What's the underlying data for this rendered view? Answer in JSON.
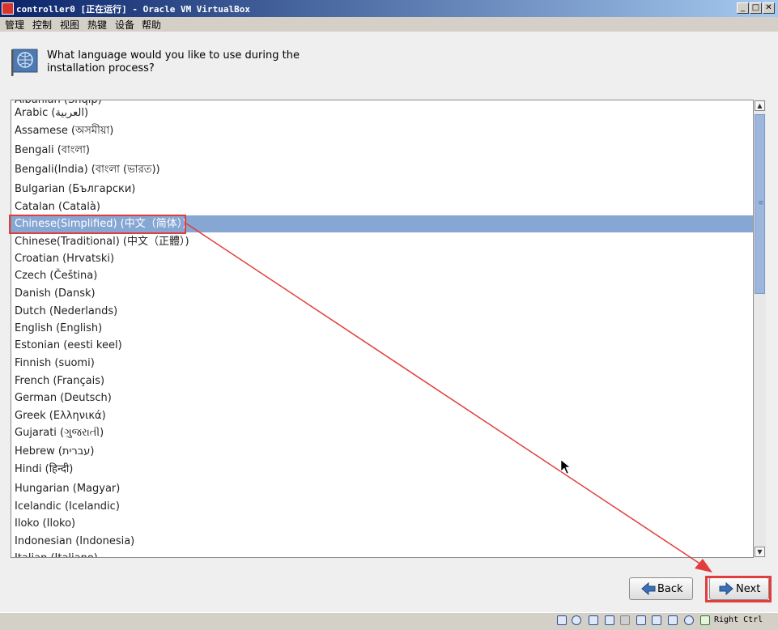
{
  "window": {
    "title": "controller0 [正在运行] - Oracle VM VirtualBox",
    "minimize_glyph": "_",
    "maximize_glyph": "□",
    "close_glyph": "✕"
  },
  "menu": [
    "管理",
    "控制",
    "视图",
    "热键",
    "设备",
    "帮助"
  ],
  "installer": {
    "question": "What language would you like to use during the installation process?",
    "languages": [
      "Albanian (Shqip)",
      "Arabic (العربية)",
      "Assamese (অসমীয়া)",
      "Bengali (বাংলা)",
      "Bengali(India) (বাংলা (ভারত))",
      "Bulgarian (Български)",
      "Catalan (Català)",
      "Chinese(Simplified) (中文（简体）)",
      "Chinese(Traditional) (中文（正體）)",
      "Croatian (Hrvatski)",
      "Czech (Čeština)",
      "Danish (Dansk)",
      "Dutch (Nederlands)",
      "English (English)",
      "Estonian (eesti keel)",
      "Finnish (suomi)",
      "French (Français)",
      "German (Deutsch)",
      "Greek (Ελληνικά)",
      "Gujarati (ગુજરાતી)",
      "Hebrew (עברית)",
      "Hindi (हिन्दी)",
      "Hungarian (Magyar)",
      "Icelandic (Icelandic)",
      "Iloko (Iloko)",
      "Indonesian (Indonesia)",
      "Italian (Italiano)"
    ],
    "selected_language": "Chinese(Simplified) (中文（简体）)",
    "buttons": {
      "back": "Back",
      "next": "Next"
    }
  },
  "status_bar": {
    "icons": [
      "hard-disk-icon",
      "optical-drive-icon",
      "network-icon",
      "usb-icon",
      "shared-folders-icon",
      "display-icon",
      "video-capture-icon",
      "cpu-virtualization-icon",
      "mouse-integration-icon",
      "keyboard-capture-icon",
      "arrow-down-icon"
    ],
    "host_key": "Right Ctrl"
  },
  "colors": {
    "selection": "#86a6d3",
    "annotation": "#e23c3c",
    "titlebar": "#0a246a"
  }
}
